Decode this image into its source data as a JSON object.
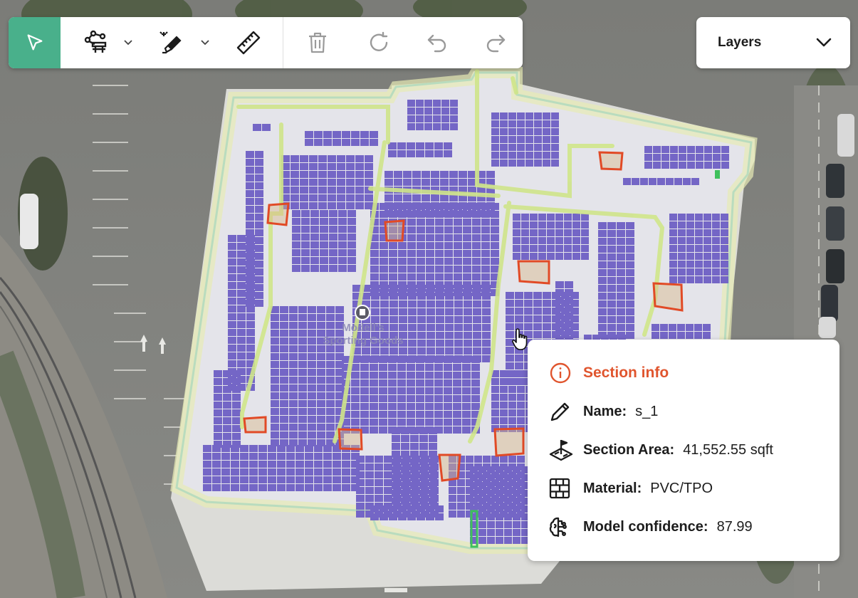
{
  "toolbar": {
    "tools": [
      {
        "name": "select-tool",
        "icon": "cursor-arrow-icon",
        "active": true
      },
      {
        "name": "draw-obstruction-tool",
        "icon": "node-shape-icon",
        "has_menu": true
      },
      {
        "name": "magic-marker-tool",
        "icon": "magic-marker-icon",
        "has_menu": true
      },
      {
        "name": "measure-tool",
        "icon": "ruler-icon"
      },
      {
        "name": "delete-tool",
        "icon": "trash-icon"
      },
      {
        "name": "rotate-tool",
        "icon": "rotate-icon"
      },
      {
        "name": "undo-tool",
        "icon": "undo-icon"
      },
      {
        "name": "redo-tool",
        "icon": "redo-icon"
      }
    ],
    "accent_color": "#49b08b"
  },
  "layers": {
    "label": "Layers",
    "icon": "chevron-down-icon"
  },
  "map": {
    "poi_label": "Modell's Sporting Goods",
    "colors": {
      "panel": "#7466c6",
      "roof": "#e4e4ea",
      "outline": "#4fb8d3",
      "walkway": "#cfe58a",
      "obstruction": "#e14a26"
    }
  },
  "section_info": {
    "title": "Section info",
    "title_color": "#e0552e",
    "rows": [
      {
        "label": "Name:",
        "value": "s_1",
        "icon": "pencil-icon"
      },
      {
        "label": "Section Area:",
        "value": "41,552.55 sqft",
        "icon": "area-flag-icon"
      },
      {
        "label": "Material:",
        "value": "PVC/TPO",
        "icon": "brick-wall-icon"
      },
      {
        "label": "Model confidence:",
        "value": "87.99",
        "icon": "brain-icon"
      }
    ]
  }
}
